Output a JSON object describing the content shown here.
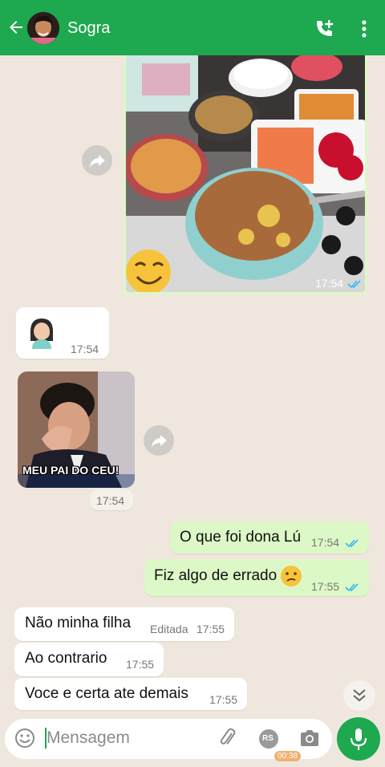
{
  "header": {
    "contact_name": "Sogra"
  },
  "messages": {
    "photo_time": "17:54",
    "sticker1_time": "17:54",
    "sticker2_caption": "MEU PAI DO CEU!",
    "sticker2_time": "17:54",
    "out1_text": "O que foi dona Lú",
    "out1_time": "17:54",
    "out2_text": "Fiz algo de errado",
    "out2_time": "17:55",
    "in1_text": "Não minha filha",
    "in1_edited": "Editada",
    "in1_time": "17:55",
    "in2_text": "Ao contrario",
    "in2_time": "17:55",
    "in3_text": "Voce e certa ate demais",
    "in3_time": "17:55"
  },
  "composer": {
    "placeholder": "Mensagem",
    "rs_badge": "RS",
    "timer": "00:38"
  },
  "colors": {
    "header": "#1ea84f",
    "outgoing_bubble": "#dcf8c6",
    "incoming_bubble": "#ffffff",
    "read_ticks": "#34b7f1"
  },
  "icons": [
    "back-arrow-icon",
    "add-call-icon",
    "more-vertical-icon",
    "forward-icon",
    "emoji-icon",
    "attach-icon",
    "camera-icon",
    "mic-icon",
    "chevron-double-down-icon"
  ]
}
